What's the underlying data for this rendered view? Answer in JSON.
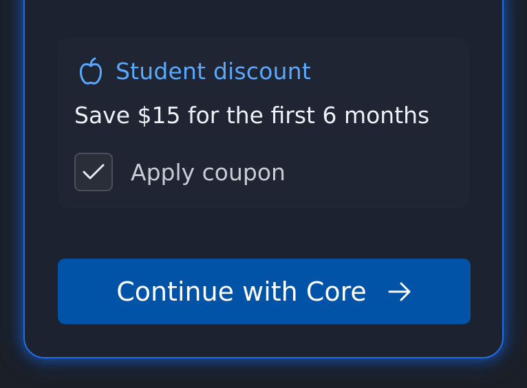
{
  "discount": {
    "title": "Student discount",
    "description": "Save $15 for the first 6 months",
    "coupon_label": "Apply coupon",
    "coupon_checked": true,
    "icon": "apple-icon"
  },
  "cta": {
    "label": "Continue with Core",
    "icon": "arrow-right-icon"
  },
  "colors": {
    "accent": "#1f6fe6",
    "link": "#59a9ff",
    "button": "#0053a6",
    "card_bg": "#1d2230",
    "page_bg": "#1b1f27"
  }
}
